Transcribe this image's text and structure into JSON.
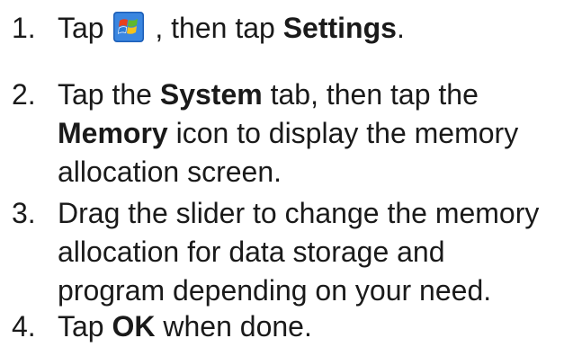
{
  "steps": [
    {
      "number": "1.",
      "lines": [
        {
          "p1": "Tap ",
          "p2": " , then tap ",
          "b1": "Settings",
          "p3": "."
        }
      ],
      "icon": "windows-start-icon"
    },
    {
      "number": "2.",
      "line1": {
        "p1": "Tap the ",
        "b1": "System",
        "p2": " tab, then tap the"
      },
      "line2": {
        "b1": "Memory",
        "p1": " icon to display the memory"
      },
      "line3": "allocation screen."
    },
    {
      "number": "3.",
      "line1": "Drag the slider to change the memory",
      "line2": "allocation for data storage and",
      "line3": "program depending on your need."
    },
    {
      "number": "4.",
      "line1": {
        "p1": "Tap ",
        "b1": "OK",
        "p2": " when done."
      }
    }
  ],
  "colors": {
    "text": "#1a1a1a",
    "flag_red": "#e8401c",
    "flag_green": "#5fb82e",
    "flag_blue": "#2a7bd6",
    "flag_yellow": "#f6c21a"
  }
}
